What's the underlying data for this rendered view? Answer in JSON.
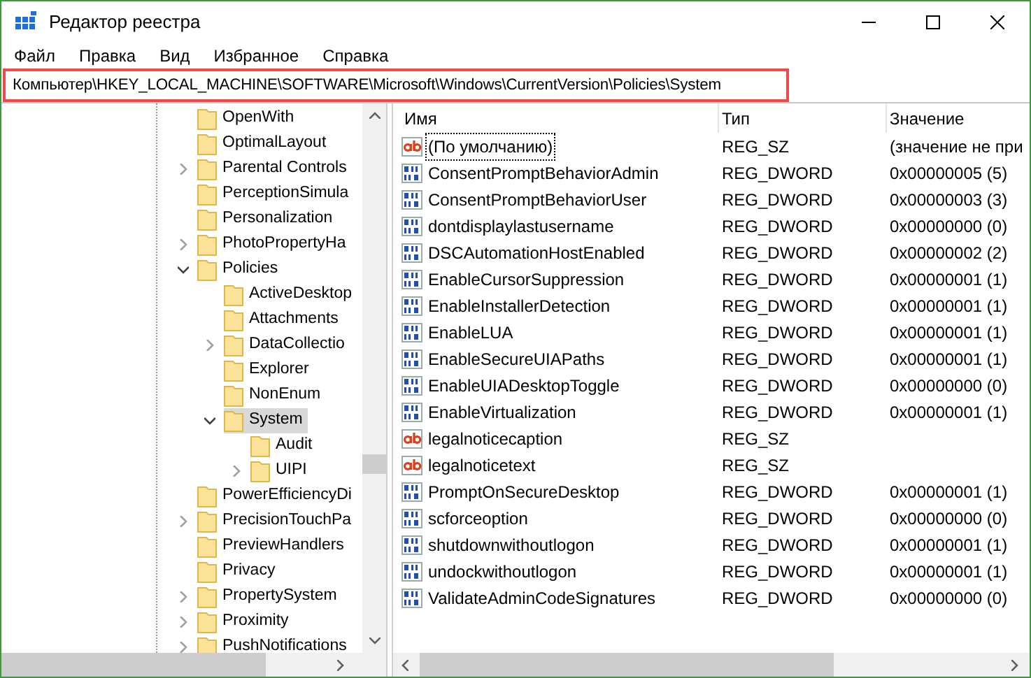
{
  "window": {
    "title": "Редактор реестра"
  },
  "menu": [
    "Файл",
    "Правка",
    "Вид",
    "Избранное",
    "Справка"
  ],
  "address": "Компьютер\\HKEY_LOCAL_MACHINE\\SOFTWARE\\Microsoft\\Windows\\CurrentVersion\\Policies\\System",
  "tree": [
    {
      "label": "OpenWith",
      "has_children": false,
      "selected": false
    },
    {
      "label": "OptimalLayout",
      "has_children": false,
      "selected": false
    },
    {
      "label": "Parental Controls",
      "has_children": true,
      "expanded": false,
      "selected": false
    },
    {
      "label": "PerceptionSimula",
      "has_children": false,
      "selected": false
    },
    {
      "label": "Personalization",
      "has_children": false,
      "selected": false
    },
    {
      "label": "PhotoPropertyHa",
      "has_children": true,
      "expanded": false,
      "selected": false
    },
    {
      "label": "Policies",
      "has_children": true,
      "expanded": true,
      "selected": false,
      "children": [
        {
          "label": "ActiveDesktop",
          "has_children": false,
          "selected": false
        },
        {
          "label": "Attachments",
          "has_children": false,
          "selected": false
        },
        {
          "label": "DataCollectio",
          "has_children": true,
          "expanded": false,
          "selected": false
        },
        {
          "label": "Explorer",
          "has_children": false,
          "selected": false
        },
        {
          "label": "NonEnum",
          "has_children": false,
          "selected": false
        },
        {
          "label": "System",
          "has_children": true,
          "expanded": true,
          "selected": true,
          "children": [
            {
              "label": "Audit",
              "has_children": false,
              "selected": false
            },
            {
              "label": "UIPI",
              "has_children": true,
              "expanded": false,
              "selected": false
            }
          ]
        }
      ]
    },
    {
      "label": "PowerEfficiencyDi",
      "has_children": false,
      "selected": false
    },
    {
      "label": "PrecisionTouchPa",
      "has_children": true,
      "expanded": false,
      "selected": false
    },
    {
      "label": "PreviewHandlers",
      "has_children": false,
      "selected": false
    },
    {
      "label": "Privacy",
      "has_children": false,
      "selected": false
    },
    {
      "label": "PropertySystem",
      "has_children": true,
      "expanded": false,
      "selected": false
    },
    {
      "label": "Proximity",
      "has_children": true,
      "expanded": false,
      "selected": false
    },
    {
      "label": "PushNotifications",
      "has_children": true,
      "expanded": false,
      "selected": false
    }
  ],
  "table": {
    "columns": [
      "Имя",
      "Тип",
      "Значение"
    ],
    "rows": [
      {
        "kind": "sz",
        "focused": true,
        "name": "(По умолчанию)",
        "type": "REG_SZ",
        "value": "(значение не при"
      },
      {
        "kind": "dword",
        "focused": false,
        "name": "ConsentPromptBehaviorAdmin",
        "type": "REG_DWORD",
        "value": "0x00000005 (5)"
      },
      {
        "kind": "dword",
        "focused": false,
        "name": "ConsentPromptBehaviorUser",
        "type": "REG_DWORD",
        "value": "0x00000003 (3)"
      },
      {
        "kind": "dword",
        "focused": false,
        "name": "dontdisplaylastusername",
        "type": "REG_DWORD",
        "value": "0x00000000 (0)"
      },
      {
        "kind": "dword",
        "focused": false,
        "name": "DSCAutomationHostEnabled",
        "type": "REG_DWORD",
        "value": "0x00000002 (2)"
      },
      {
        "kind": "dword",
        "focused": false,
        "name": "EnableCursorSuppression",
        "type": "REG_DWORD",
        "value": "0x00000001 (1)"
      },
      {
        "kind": "dword",
        "focused": false,
        "name": "EnableInstallerDetection",
        "type": "REG_DWORD",
        "value": "0x00000001 (1)"
      },
      {
        "kind": "dword",
        "focused": false,
        "name": "EnableLUA",
        "type": "REG_DWORD",
        "value": "0x00000001 (1)"
      },
      {
        "kind": "dword",
        "focused": false,
        "name": "EnableSecureUIAPaths",
        "type": "REG_DWORD",
        "value": "0x00000001 (1)"
      },
      {
        "kind": "dword",
        "focused": false,
        "name": "EnableUIADesktopToggle",
        "type": "REG_DWORD",
        "value": "0x00000000 (0)"
      },
      {
        "kind": "dword",
        "focused": false,
        "name": "EnableVirtualization",
        "type": "REG_DWORD",
        "value": "0x00000001 (1)"
      },
      {
        "kind": "sz",
        "focused": false,
        "name": "legalnoticecaption",
        "type": "REG_SZ"
      },
      {
        "kind": "sz",
        "focused": false,
        "name": "legalnoticetext",
        "type": "REG_SZ"
      },
      {
        "kind": "dword",
        "focused": false,
        "name": "PromptOnSecureDesktop",
        "type": "REG_DWORD",
        "value": "0x00000001 (1)"
      },
      {
        "kind": "dword",
        "focused": false,
        "name": "scforceoption",
        "type": "REG_DWORD",
        "value": "0x00000000 (0)"
      },
      {
        "kind": "dword",
        "focused": false,
        "name": "shutdownwithoutlogon",
        "type": "REG_DWORD",
        "value": "0x00000001 (1)"
      },
      {
        "kind": "dword",
        "focused": false,
        "name": "undockwithoutlogon",
        "type": "REG_DWORD",
        "value": "0x00000001 (1)"
      },
      {
        "kind": "dword",
        "focused": false,
        "name": "ValidateAdminCodeSignatures",
        "type": "REG_DWORD",
        "value": "0x00000000 (0)"
      }
    ]
  }
}
